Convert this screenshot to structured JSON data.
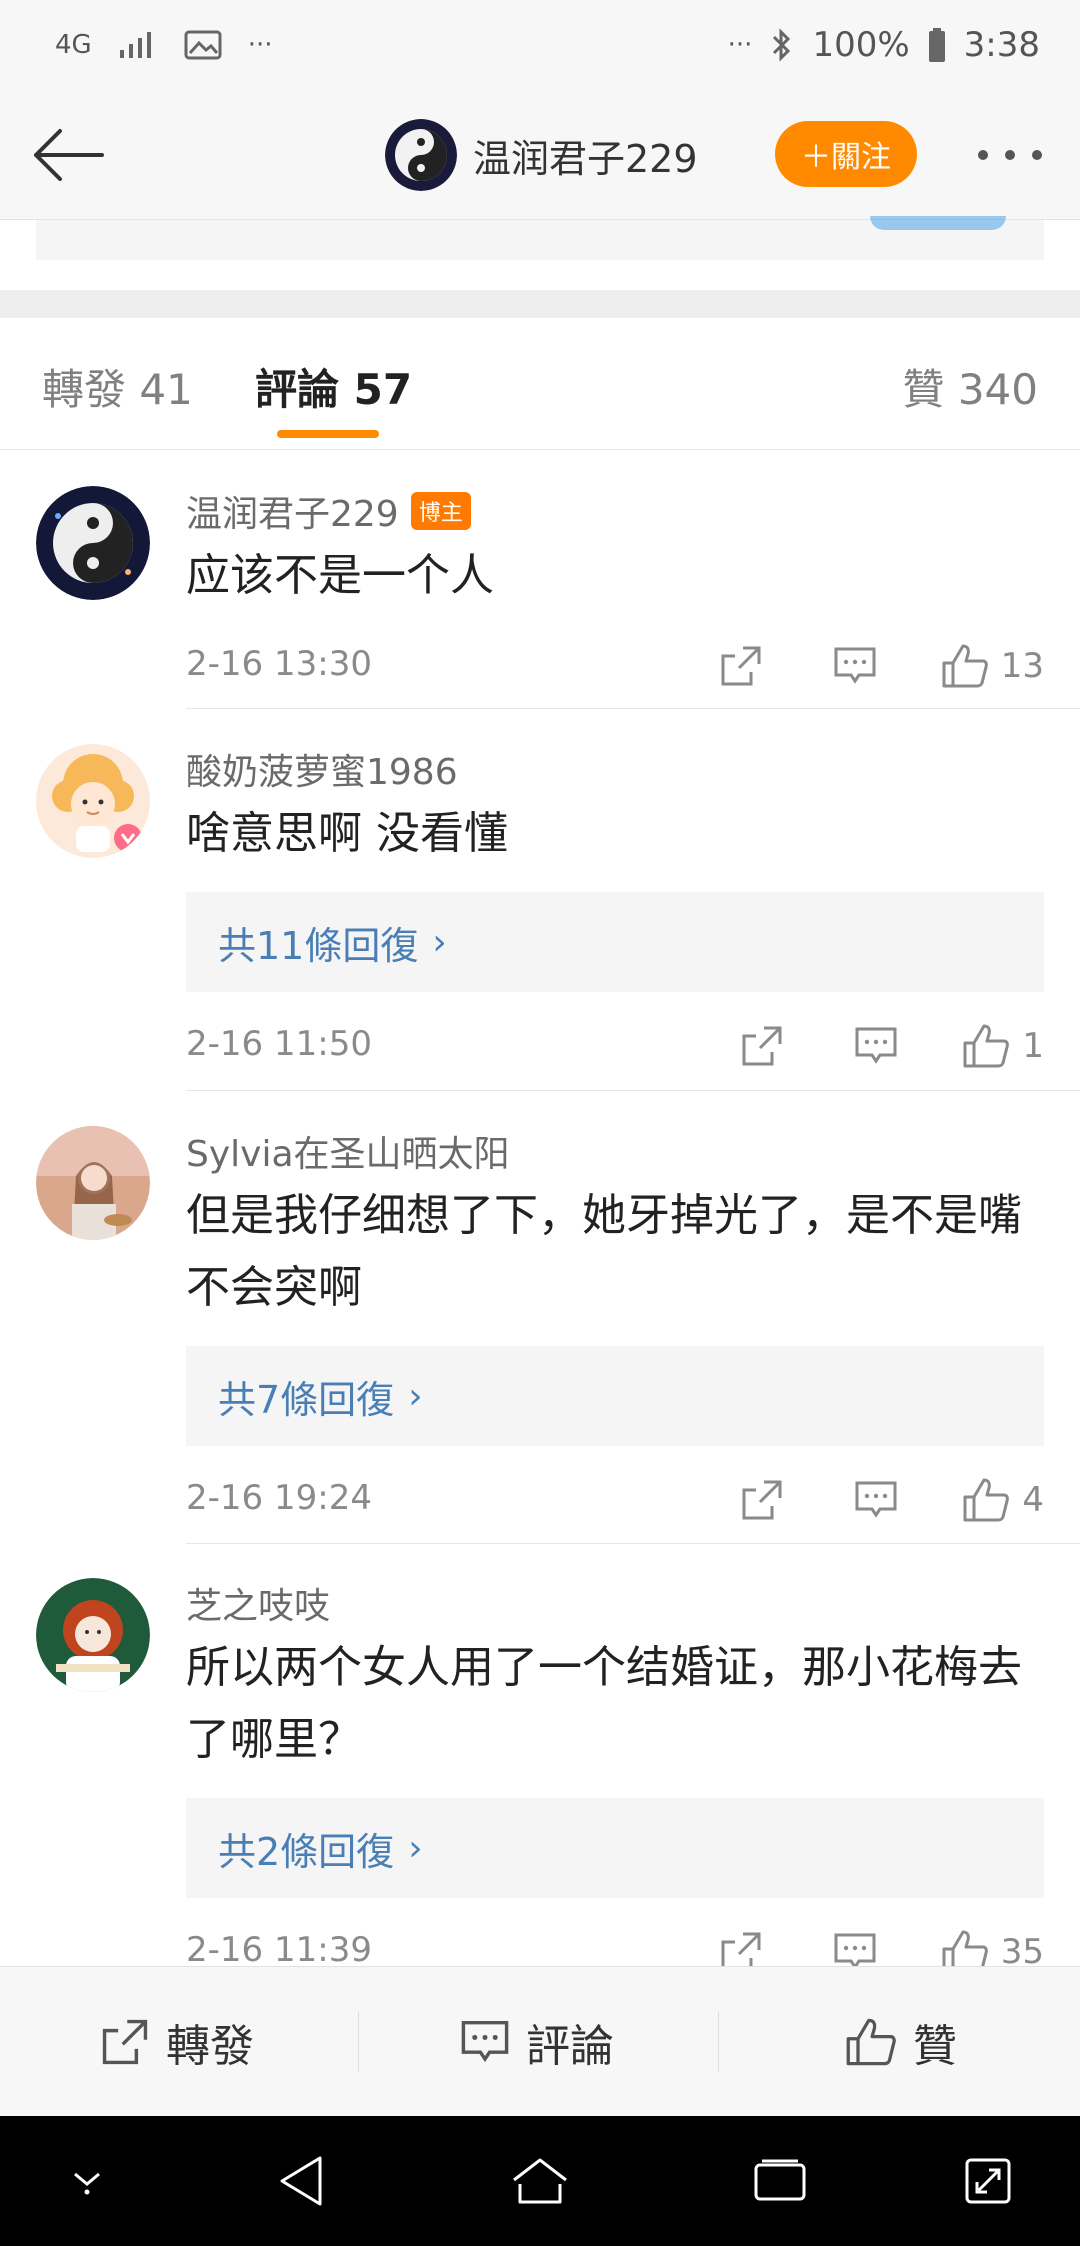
{
  "status_bar": {
    "network": "4G",
    "more": "···",
    "more_right": "···",
    "battery": "100%",
    "time": "3:38"
  },
  "header": {
    "username": "温润君子229",
    "follow_label": "＋關注"
  },
  "tabs": {
    "repost": "轉發 41",
    "comment": "評論 57",
    "like": "贊 340"
  },
  "comments": [
    {
      "name": "温润君子229",
      "badge": "博主",
      "text": "应该不是一个人",
      "time": "2-16 13:30",
      "likes": "13"
    },
    {
      "name": "酸奶菠萝蜜1986",
      "text": "啥意思啊 没看懂",
      "replies": "共11條回復",
      "time": "2-16 11:50",
      "likes": "1"
    },
    {
      "name": "Sylvia在圣山晒太阳",
      "text": "但是我仔细想了下，她牙掉光了，是不是嘴不会突啊",
      "replies": "共7條回復",
      "time": "2-16 19:24",
      "likes": "4"
    },
    {
      "name": "芝之吱吱",
      "text": "所以两个女人用了一个结婚证，那小花梅去了哪里？",
      "replies": "共2條回復",
      "time": "2-16 11:39",
      "likes": "35"
    }
  ],
  "bottom_bar": {
    "repost": "轉發",
    "comment": "評論",
    "like": "贊"
  },
  "colors": {
    "accent": "#ff8a00",
    "link": "#4a7fb5"
  }
}
